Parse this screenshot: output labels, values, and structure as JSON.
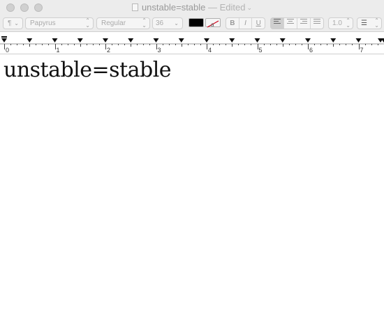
{
  "window": {
    "title": "unstable=stable",
    "status": "— Edited",
    "chevron": "⌄"
  },
  "toolbar": {
    "paragraph_style": "¶",
    "font_family": "Papyrus",
    "font_style": "Regular",
    "font_size": "36",
    "text_color": "#000000",
    "bold": "B",
    "italic": "I",
    "underline": "U",
    "line_spacing": "1.0",
    "list_glyph": "☰",
    "alignment_selected": "left"
  },
  "ruler": {
    "labels": [
      "0",
      "1",
      "2",
      "3",
      "4",
      "5",
      "6",
      "7"
    ]
  },
  "document": {
    "text": "unstable=stable"
  }
}
